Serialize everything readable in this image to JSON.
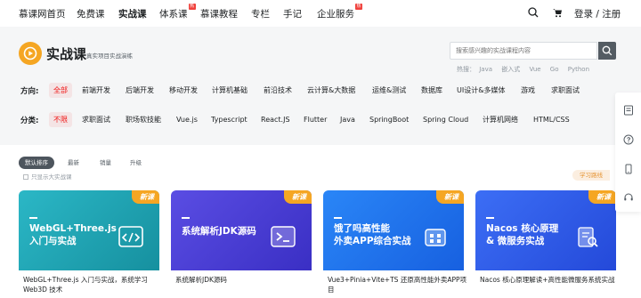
{
  "nav": {
    "items": [
      {
        "label": "慕课网首页",
        "hot": false,
        "active": false
      },
      {
        "label": "免费课",
        "hot": false,
        "active": false
      },
      {
        "label": "实战课",
        "hot": false,
        "active": true
      },
      {
        "label": "体系课",
        "hot": true,
        "active": false
      },
      {
        "label": "慕课教程",
        "hot": false,
        "active": false
      },
      {
        "label": "专栏",
        "hot": false,
        "active": false
      },
      {
        "label": "手记",
        "hot": false,
        "active": false
      },
      {
        "label": "企业服务",
        "hot": true,
        "active": false
      }
    ],
    "hot_label": "热",
    "login": "登录 / 注册"
  },
  "brand": {
    "title": "实战课",
    "subtitle": "真实项目实战演练"
  },
  "search": {
    "placeholder": "搜索感兴趣的实战课程内容",
    "hot_prefix": "热搜：",
    "hot_words": [
      "Java",
      "嵌入式",
      "Vue",
      "Go",
      "Python"
    ]
  },
  "filters": {
    "direction": {
      "label": "方向:",
      "options": [
        "全部",
        "前端开发",
        "后端开发",
        "移动开发",
        "计算机基础",
        "前沿技术",
        "云计算&大数据",
        "运维&测试",
        "数据库",
        "UI设计&多媒体",
        "游戏",
        "求职面试"
      ],
      "selected": 0
    },
    "category": {
      "label": "分类:",
      "options": [
        "不限",
        "求职面试",
        "职场软技能",
        "Vue.js",
        "Typescript",
        "React.JS",
        "Flutter",
        "Java",
        "SpringBoot",
        "Spring Cloud",
        "计算机网络",
        "HTML/CSS"
      ],
      "selected": 0
    }
  },
  "sort": {
    "options": [
      "默认排序",
      "最新",
      "销量",
      "升级"
    ],
    "selected": 0,
    "only_vip": "只显示大实战课",
    "route_tag": "学习路线"
  },
  "cards": [
    {
      "tag": "新课",
      "title_lines": [
        "WebGL+Three.js",
        "入门与实战"
      ],
      "desc": "WebGL+Three.js 入门与实战，系统学习 Web3D 技术",
      "color": "#1aa7b8",
      "icon": "code-window-icon"
    },
    {
      "tag": "新课",
      "title_lines": [
        "系统解析JDK源码"
      ],
      "desc": "系统解析JDK源码",
      "color": "#4b3fd6",
      "icon": "terminal-icon"
    },
    {
      "tag": "新课",
      "title_lines": [
        "饿了吗高性能",
        "外卖APP综合实战"
      ],
      "desc": "Vue3+Pinia+Vite+TS 还原高性能外卖APP项目",
      "color": "#1d6ff0",
      "icon": "app-grid-icon"
    },
    {
      "tag": "新课",
      "title_lines": [
        "Nacos 核心原理",
        "& 微服务实战"
      ],
      "desc": "Nacos 核心原理解读+高性能微服务系统实战",
      "color": "#2f5df2",
      "icon": "document-search-icon"
    }
  ],
  "colors": {
    "accent_red": "#f01414",
    "new_tag": "#f5a623",
    "logo": "#f5a623"
  }
}
